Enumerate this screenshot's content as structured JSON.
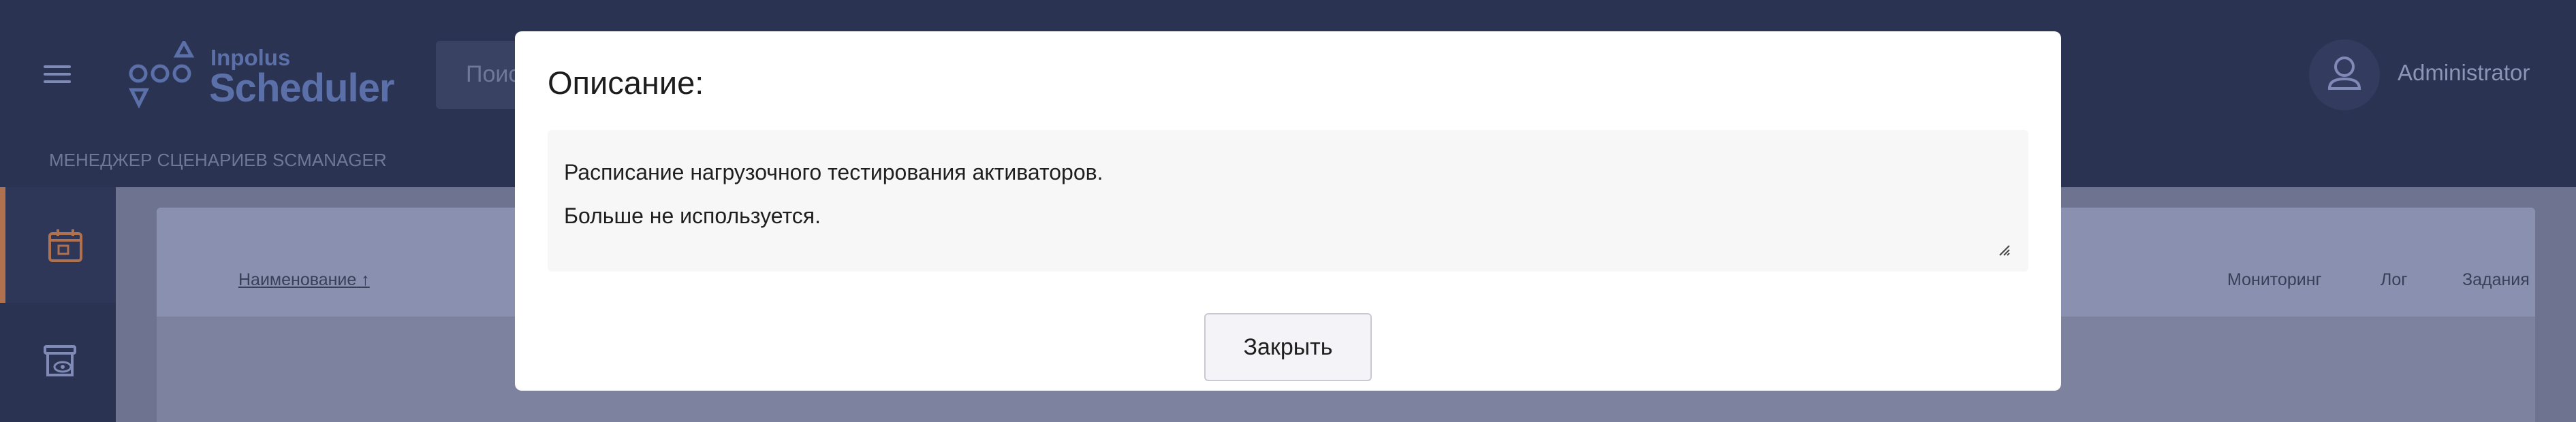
{
  "header": {
    "logo_small": "Inpolus",
    "logo_big": "Scheduler",
    "search_placeholder": "Поис",
    "user_name": "Administrator"
  },
  "breadcrumb": "МЕНЕДЖЕР СЦЕНАРИЕВ SCMANAGER",
  "table": {
    "columns": {
      "name": "Наименование",
      "monitoring": "Мониторинг",
      "log": "Лог",
      "tasks": "Задания"
    },
    "sort_indicator": "↑"
  },
  "modal": {
    "title": "Описание:",
    "text_lines": [
      "Расписание нагрузочного тестирования активаторов.",
      "Больше не используется."
    ],
    "close_label": "Закрыть"
  },
  "colors": {
    "header_bg": "#2b3352",
    "accent": "#b0724e",
    "logo": "#5b6fa8"
  },
  "icons": {
    "menu": "hamburger-icon",
    "logo": "inpolus-logo-icon",
    "user": "user-icon",
    "calendar": "calendar-icon",
    "archive": "archive-view-icon"
  }
}
